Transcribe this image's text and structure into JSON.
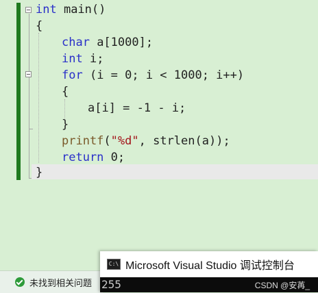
{
  "code": {
    "line1": {
      "kw": "int",
      "rest": " main()"
    },
    "line2": "{",
    "line3": {
      "kw": "char",
      "rest": " a[1000];"
    },
    "line4": {
      "kw": "int",
      "rest": " i;"
    },
    "line5": {
      "kw": "for",
      "rest": " (i = 0; i < 1000; i++)"
    },
    "line6": "{",
    "line7": "a[i] = -1 - i;",
    "line8": "}",
    "line9": {
      "fn": "printf",
      "open": "(",
      "str": "\"%d\"",
      "rest": ", strlen(a));"
    },
    "line10": {
      "kw": "return",
      "rest": " 0;"
    },
    "line11": "}"
  },
  "status": {
    "message": "未找到相关问题"
  },
  "console": {
    "title": "Microsoft Visual Studio 调试控制台",
    "icon_text": "C:\\",
    "output": "255",
    "ghost_text": "…… ……"
  },
  "watermark": "CSDN @安苒_",
  "colors": {
    "editor_bg": "#d8efd3",
    "keyword": "#2a30c9",
    "string": "#a3151b",
    "change_bar": "#1f7a1f"
  }
}
